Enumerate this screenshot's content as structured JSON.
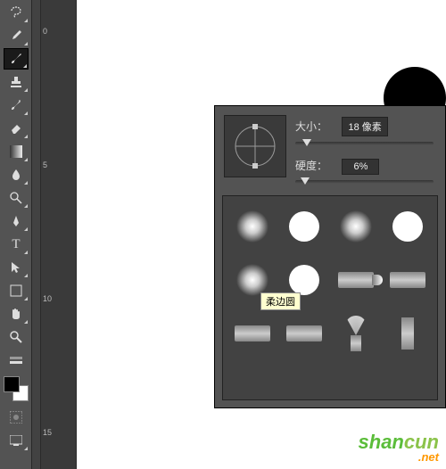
{
  "tools": {
    "move": "move-tool",
    "lasso": "lasso-tool",
    "magic": "magic-wand-tool",
    "crop": "crop-tool",
    "eyedrop": "eyedropper-tool",
    "brush": "brush-tool",
    "stamp": "stamp-tool",
    "history": "history-brush-tool",
    "eraser": "eraser-tool",
    "gradient": "gradient-tool",
    "blur": "blur-tool",
    "dodge": "dodge-tool",
    "pen": "pen-tool",
    "type": "type-tool",
    "select": "path-select-tool",
    "shape": "shape-tool",
    "hand": "hand-tool",
    "zoom": "zoom-tool"
  },
  "ruler_marks": [
    "0",
    "5",
    "10",
    "15"
  ],
  "brush_panel": {
    "size_label": "大小：",
    "size_value": "18",
    "size_units": "像素",
    "hard_label": "硬度：",
    "hard_value": "6%",
    "tooltip": "柔边圆",
    "presets": [
      {
        "name": "soft-round",
        "type": "soft"
      },
      {
        "name": "hard-round",
        "type": "hard"
      },
      {
        "name": "soft-round-2",
        "type": "soft"
      },
      {
        "name": "hard-round-2",
        "type": "hard"
      },
      {
        "name": "soft-round-3",
        "type": "soft"
      },
      {
        "name": "hard-round-3",
        "type": "hard"
      },
      {
        "name": "round-bristle",
        "type": "bristle"
      },
      {
        "name": "flat-bristle",
        "type": "flat"
      },
      {
        "name": "flat-1",
        "type": "flat"
      },
      {
        "name": "flat-2",
        "type": "flat"
      },
      {
        "name": "fan-brush",
        "type": "fan"
      },
      {
        "name": "square-brush",
        "type": "square"
      }
    ]
  },
  "watermark": {
    "t1": "shan",
    "t2": "cun",
    "t3": ".net"
  }
}
